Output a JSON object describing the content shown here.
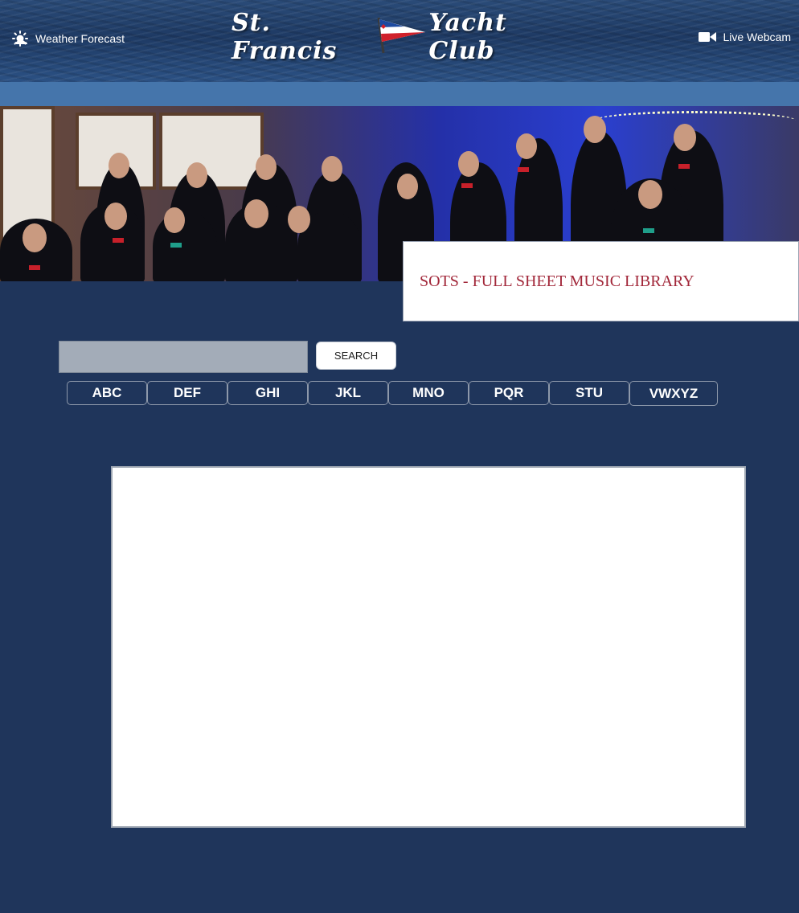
{
  "header": {
    "weather_label": "Weather Forecast",
    "brand_left": "St. Francis",
    "brand_right": "Yacht Club",
    "webcam_label": "Live Webcam"
  },
  "page": {
    "title": "SOTS - FULL SHEET MUSIC LIBRARY"
  },
  "search": {
    "value": "",
    "button_label": "SEARCH"
  },
  "alpha_index": [
    "ABC",
    "DEF",
    "GHI",
    "JKL",
    "MNO",
    "PQR",
    "STU",
    "VWXYZ"
  ],
  "colors": {
    "page_background": "#1f355b",
    "nav_bar": "#4575ab",
    "title_text": "#a2283a"
  },
  "icons": {
    "weather": "weather-sun-icon",
    "burgee": "club-burgee-flag",
    "webcam": "video-camera-icon"
  }
}
